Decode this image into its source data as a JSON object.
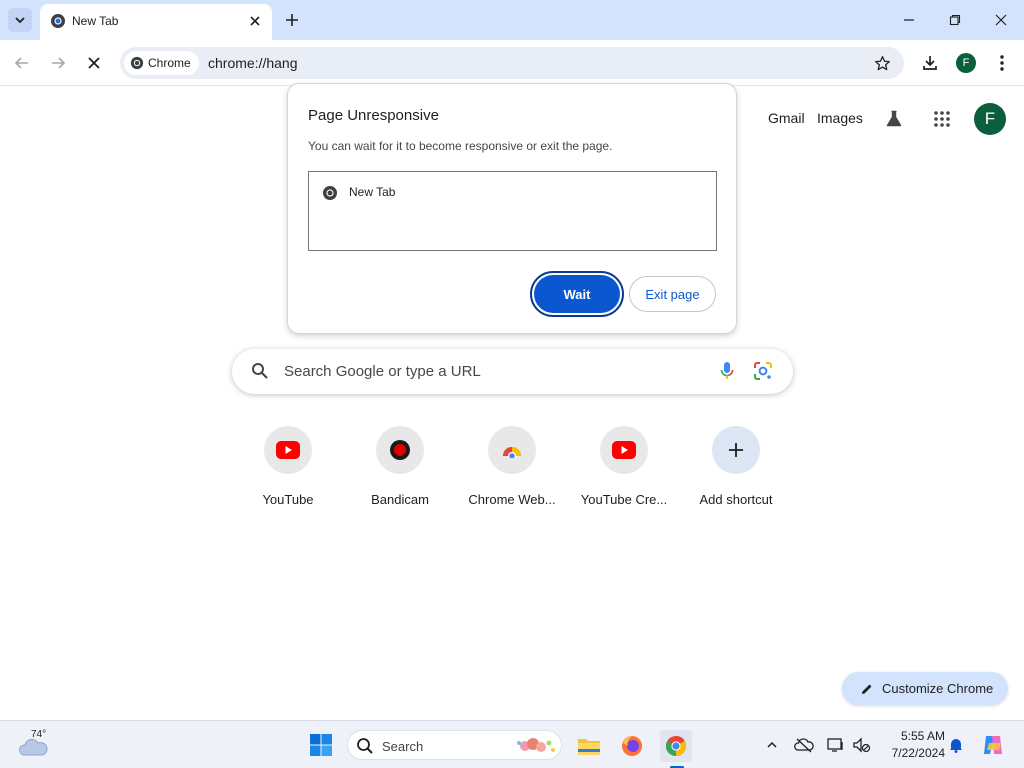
{
  "browser": {
    "tab": {
      "title": "New Tab"
    },
    "chip_label": "Chrome",
    "url": "chrome://hang",
    "profile_initial": "F"
  },
  "ntp": {
    "links": {
      "gmail": "Gmail",
      "images": "Images"
    },
    "avatar_initial": "F",
    "search_placeholder": "Search Google or type a URL",
    "shortcuts": [
      {
        "label": "YouTube",
        "icon": "youtube-icon"
      },
      {
        "label": "Bandicam",
        "icon": "bandicam-icon"
      },
      {
        "label": "Chrome Web...",
        "icon": "chrome-web-store-icon"
      },
      {
        "label": "YouTube Cre...",
        "icon": "youtube-icon"
      },
      {
        "label": "Add shortcut",
        "icon": "plus-icon"
      }
    ],
    "customize_label": "Customize Chrome"
  },
  "dialog": {
    "title": "Page Unresponsive",
    "message": "You can wait for it to become responsive or exit the page.",
    "list_item": "New Tab",
    "wait_label": "Wait",
    "exit_label": "Exit page"
  },
  "taskbar": {
    "temperature": "74°",
    "search_label": "Search",
    "time": "5:55 AM",
    "date": "7/22/2024"
  },
  "colors": {
    "accent": "#0b57d0",
    "tabstrip": "#d3e3fd",
    "profile": "#0b5f3c"
  }
}
